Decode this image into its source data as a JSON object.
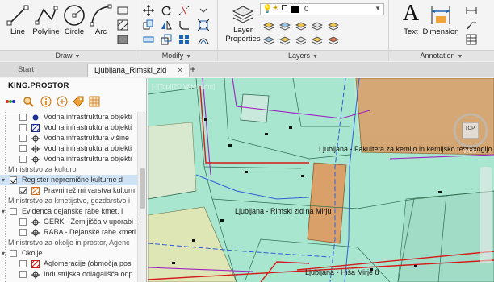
{
  "ribbon": {
    "draw": {
      "panel_label": "Draw",
      "line": "Line",
      "polyline": "Polyline",
      "circle": "Circle",
      "arc": "Arc"
    },
    "modify": {
      "panel_label": "Modify"
    },
    "layers": {
      "panel_label": "Layers",
      "layer_properties": "Layer Properties",
      "current_layer": "0"
    },
    "annotation": {
      "panel_label": "Annotation",
      "text": "Text",
      "dimension": "Dimension"
    }
  },
  "tabs": {
    "start": "Start",
    "drawing": "Ljubljana_Rimski_zid",
    "add": "+"
  },
  "palette": {
    "title": "KING.PROSTOR",
    "rows": [
      {
        "label": "Vodna infrastruktura objekti",
        "type": "layer",
        "checked": false,
        "symbol": "blue-dot"
      },
      {
        "label": "Vodna infrastruktura objekti",
        "type": "layer",
        "checked": false,
        "symbol": "hatch"
      },
      {
        "label": "Vodna infrastruktura višine",
        "type": "layer",
        "checked": false,
        "symbol": "cross-dot"
      },
      {
        "label": "Vodna infrastruktura objekti",
        "type": "layer",
        "checked": false,
        "symbol": "cross-dot"
      },
      {
        "label": "Vodna infrastruktura objekti",
        "type": "layer",
        "checked": false,
        "symbol": "cross-dot"
      },
      {
        "label": "Ministrstvo za kulturo",
        "type": "group"
      },
      {
        "label": "Register nepremične kulturne d",
        "type": "folder",
        "checked": true
      },
      {
        "label": "Pravni režimi varstva kulturn",
        "type": "layer",
        "checked": true,
        "symbol": "orange-hatch"
      },
      {
        "label": "Ministrstvo za kmetijstvo, gozdarstvo i",
        "type": "group"
      },
      {
        "label": "Evidenca dejanske rabe kmet. i",
        "type": "folder",
        "checked": false
      },
      {
        "label": "GERK - Zemljišča v uporabi l",
        "type": "layer",
        "checked": false,
        "symbol": "cross-dot"
      },
      {
        "label": "RABA - Dejanske rabe kmeti",
        "type": "layer",
        "checked": false,
        "symbol": "cross-dot"
      },
      {
        "label": "Ministrstvo za okolje in prostor, Agenc",
        "type": "group"
      },
      {
        "label": "Okolje",
        "type": "folder",
        "checked": false
      },
      {
        "label": "Aglomeracije (območja pos",
        "type": "layer",
        "checked": false,
        "symbol": "red-hatch"
      },
      {
        "label": "Industrijska odlagališča odp",
        "type": "layer",
        "checked": false,
        "symbol": "cross-dot"
      }
    ]
  },
  "map": {
    "viewport_control": "[-][Top][2D Wireframe]",
    "labels": {
      "fakulteta": "Ljubljana - Fakulteta za kemijo in kemijsko tehnologijo",
      "rimski_zid": "Ljubljana - Rimski zid na Mirju",
      "hisa": "Ljubljana - Hiša Mirje 8"
    },
    "viewcube": {
      "top": "TOP",
      "compass": "WCS"
    }
  },
  "colors": {
    "map_bg": "#a9e6cf",
    "building": "#d9a06a",
    "parcel_line": "#2e6b50",
    "road_blue": "#2f5fd8",
    "magenta": "#a020c0",
    "red": "#d41a1a",
    "yellow_zone": "#dfe6b5"
  }
}
